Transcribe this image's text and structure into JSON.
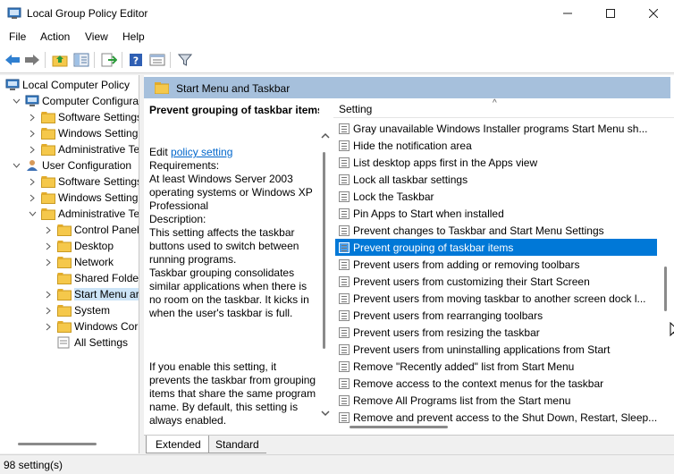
{
  "window": {
    "title": "Local Group Policy Editor"
  },
  "window_controls": {
    "minimize": "—",
    "maximize": "☐",
    "close": "✕"
  },
  "menu": [
    "File",
    "Action",
    "View",
    "Help"
  ],
  "toolbar_icons": [
    "back-arrow-icon",
    "forward-arrow-icon",
    "up-folder-icon",
    "show-hide-tree-icon",
    "export-list-icon",
    "help-icon",
    "properties-icon",
    "filter-icon"
  ],
  "tree": [
    {
      "label": "Local Computer Policy",
      "level": 0,
      "expander": "",
      "icon": "computer-policy-icon"
    },
    {
      "label": "Computer Configura",
      "level": 1,
      "expander": "v",
      "icon": "computer-icon"
    },
    {
      "label": "Software Settings",
      "level": 2,
      "expander": ">",
      "icon": "folder-icon"
    },
    {
      "label": "Windows Setting",
      "level": 2,
      "expander": ">",
      "icon": "folder-icon"
    },
    {
      "label": "Administrative Te",
      "level": 2,
      "expander": ">",
      "icon": "folder-icon"
    },
    {
      "label": "User Configuration",
      "level": 1,
      "expander": "v",
      "icon": "user-icon"
    },
    {
      "label": "Software Settings",
      "level": 2,
      "expander": ">",
      "icon": "folder-icon"
    },
    {
      "label": "Windows Setting",
      "level": 2,
      "expander": ">",
      "icon": "folder-icon"
    },
    {
      "label": "Administrative Te",
      "level": 2,
      "expander": "v",
      "icon": "folder-icon"
    },
    {
      "label": "Control Panel",
      "level": 3,
      "expander": ">",
      "icon": "folder-icon"
    },
    {
      "label": "Desktop",
      "level": 3,
      "expander": ">",
      "icon": "folder-icon"
    },
    {
      "label": "Network",
      "level": 3,
      "expander": ">",
      "icon": "folder-icon"
    },
    {
      "label": "Shared Folder",
      "level": 3,
      "expander": "",
      "icon": "folder-icon"
    },
    {
      "label": "Start Menu ar",
      "level": 3,
      "expander": ">",
      "icon": "folder-icon",
      "selected": true
    },
    {
      "label": "System",
      "level": 3,
      "expander": ">",
      "icon": "folder-icon"
    },
    {
      "label": "Windows Cor",
      "level": 3,
      "expander": ">",
      "icon": "folder-icon"
    },
    {
      "label": "All Settings",
      "level": 3,
      "expander": "",
      "icon": "all-settings-icon"
    }
  ],
  "header": {
    "title": "Start Menu and Taskbar"
  },
  "description": {
    "title": "Prevent grouping of taskbar items",
    "edit_prefix": "Edit ",
    "edit_link": "policy setting",
    "requirements": "Requirements:\nAt least Windows Server 2003 operating systems or Windows XP Professional",
    "description": "Description:\nThis setting affects the taskbar buttons used to switch between running programs.",
    "paragraph2": "Taskbar grouping consolidates similar applications when there is no room on the taskbar. It kicks in when the user's taskbar is full.",
    "paragraph3": "If you enable this setting, it prevents the taskbar from grouping items that share the same program name. By default, this setting is always enabled."
  },
  "list": {
    "column": "Setting",
    "sort_glyph": "^",
    "rows": [
      "Gray unavailable Windows Installer programs Start Menu sh...",
      "Hide the notification area",
      "List desktop apps first in the Apps view",
      "Lock all taskbar settings",
      "Lock the Taskbar",
      "Pin Apps to Start when installed",
      "Prevent changes to Taskbar and Start Menu Settings",
      "Prevent grouping of taskbar items",
      "Prevent users from adding or removing toolbars",
      "Prevent users from customizing their Start Screen",
      "Prevent users from moving taskbar to another screen dock l...",
      "Prevent users from rearranging toolbars",
      "Prevent users from resizing the taskbar",
      "Prevent users from uninstalling applications from Start",
      "Remove \"Recently added\" list from Start Menu",
      "Remove access to the context menus for the taskbar",
      "Remove All Programs list from the Start menu",
      "Remove and prevent access to the Shut Down, Restart, Sleep..."
    ],
    "selected_index": 7
  },
  "tabs": [
    "Extended",
    "Standard"
  ],
  "status": {
    "text": "98 setting(s)"
  },
  "colors": {
    "selection": "#0078d7",
    "header_band": "#a6c0dc",
    "link": "#0066cc"
  }
}
